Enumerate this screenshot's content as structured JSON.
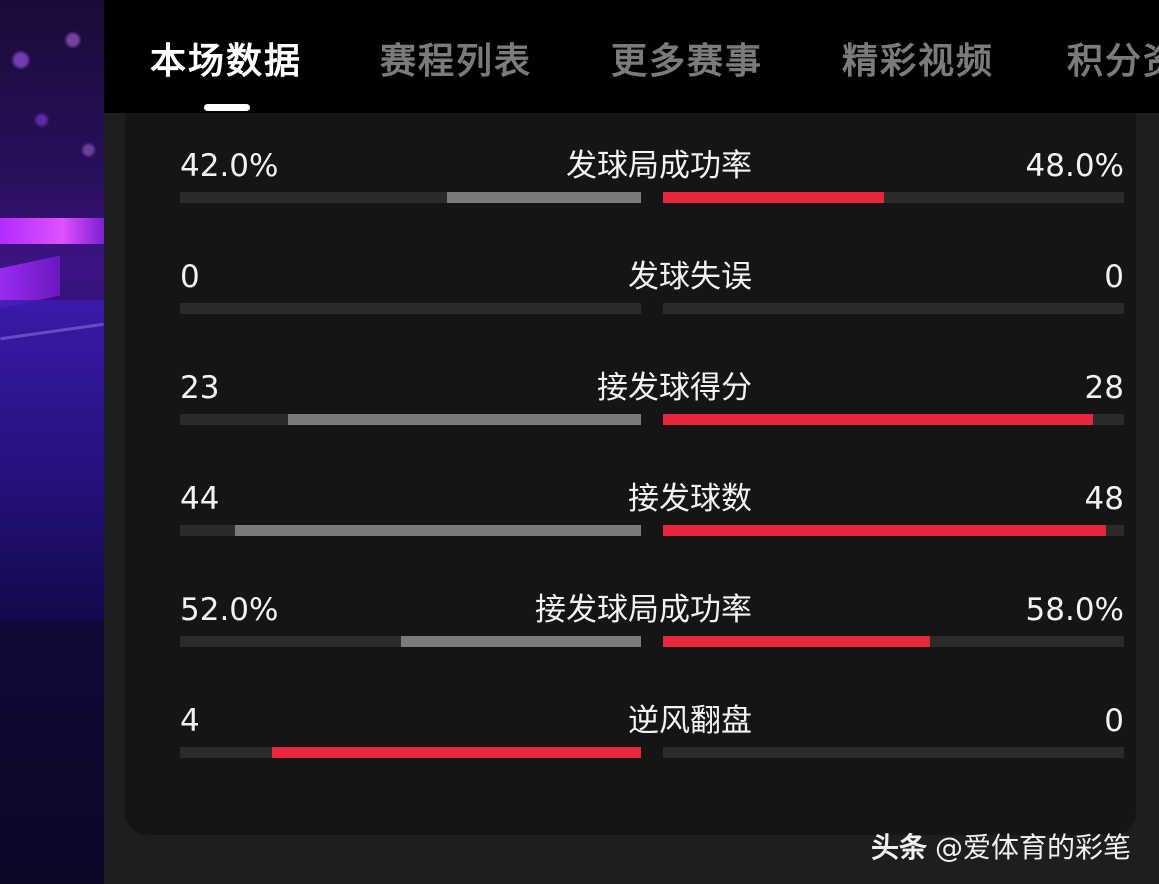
{
  "tabs": [
    {
      "label": "本场数据",
      "active": true
    },
    {
      "label": "赛程列表",
      "active": false
    },
    {
      "label": "更多赛事",
      "active": false
    },
    {
      "label": "精彩视频",
      "active": false
    },
    {
      "label": "积分资",
      "active": false
    }
  ],
  "colors": {
    "red": "#e8263e",
    "gray": "#7b7b7b",
    "track": "#2a2b2d"
  },
  "stats": [
    {
      "label": "发球局成功率",
      "left": "42.0%",
      "right": "48.0%",
      "left_fraction": 0.42,
      "right_fraction": 0.48,
      "left_color": "gray",
      "right_color": "red"
    },
    {
      "label": "发球失误",
      "left": "0",
      "right": "0",
      "left_fraction": 0,
      "right_fraction": 0,
      "left_color": "gray",
      "right_color": "red"
    },
    {
      "label": "接发球得分",
      "left": "23",
      "right": "28",
      "left_fraction": 0.7667,
      "right_fraction": 0.9333,
      "left_color": "gray",
      "right_color": "red"
    },
    {
      "label": "接发球数",
      "left": "44",
      "right": "48",
      "left_fraction": 0.88,
      "right_fraction": 0.96,
      "left_color": "gray",
      "right_color": "red"
    },
    {
      "label": "接发球局成功率",
      "left": "52.0%",
      "right": "58.0%",
      "left_fraction": 0.52,
      "right_fraction": 0.58,
      "left_color": "gray",
      "right_color": "red"
    },
    {
      "label": "逆风翻盘",
      "left": "4",
      "right": "0",
      "left_fraction": 0.8,
      "right_fraction": 0,
      "left_color": "red",
      "right_color": "gray"
    }
  ],
  "watermark": {
    "brand": "头条",
    "handle": "@爱体育的彩笔"
  }
}
